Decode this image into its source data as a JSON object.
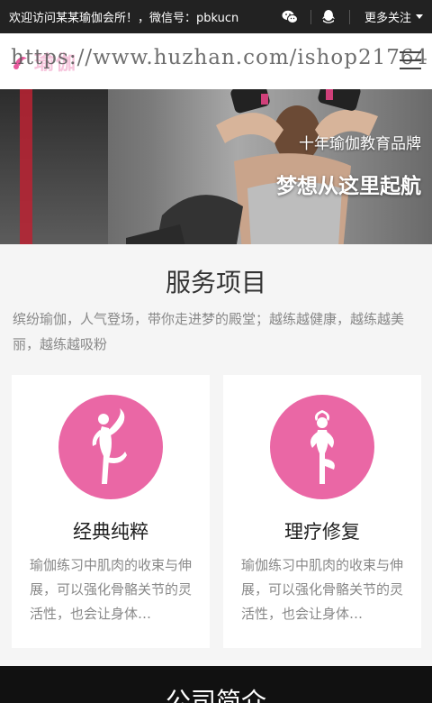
{
  "topbar": {
    "welcome": "欢迎访问某某瑜伽会所！，微信号：pbkucn",
    "wechat_icon": "wechat-icon",
    "qq_icon": "qq-icon",
    "more_label": "更多关注"
  },
  "header": {
    "logo_text": "瑜伽",
    "watermark": "https://www.huzhan.com/ishop21764"
  },
  "banner": {
    "line1": "十年瑜伽教育品牌",
    "line2": "梦想从这里起航"
  },
  "services": {
    "title": "服务项目",
    "description": "缤纷瑜伽，人气登场，带你走进梦的殿堂；越练越健康，越练越美丽，越练越吸粉",
    "cards": [
      {
        "title": "经典纯粹",
        "text": "瑜伽练习中肌肉的收束与伸展，可以强化骨骼关节的灵活性，也会让身体…",
        "icon": "yoga-pose-icon"
      },
      {
        "title": "理疗修复",
        "text": "瑜伽练习中肌肉的收束与伸展，可以强化骨骼关节的灵活性，也会让身体…",
        "icon": "yoga-tree-pose-icon"
      }
    ]
  },
  "about": {
    "title": "公司简介"
  },
  "colors": {
    "accent": "#ea67a5",
    "topbar": "#222222",
    "footer": "#111111"
  }
}
